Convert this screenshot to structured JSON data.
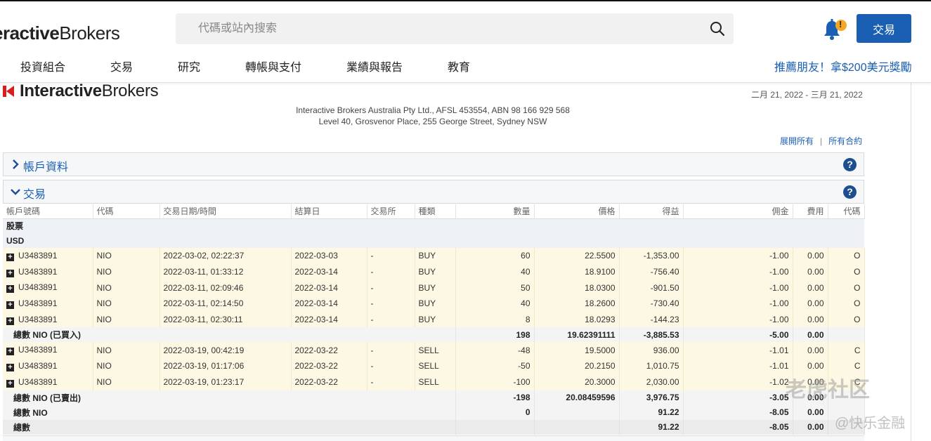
{
  "header": {
    "logo_bold": "eractive",
    "logo_regular": "Brokers",
    "search_placeholder": "代碼或站內搜索",
    "trade_button": "交易",
    "notification_badge": "!",
    "nav": [
      "投資組合",
      "交易",
      "研究",
      "轉帳與支付",
      "業績與報告",
      "教育"
    ],
    "promo": "推薦朋友！拿$200美元獎勵"
  },
  "statement": {
    "logo_bold": "Interactive",
    "logo_regular": "Brokers",
    "period": "二月 21, 2022 - 三月 21, 2022",
    "address_line1": "Interactive Brokers Australia Pty Ltd., AFSL 453554, ABN 98 166 929 568",
    "address_line2": "Level 40, Grosvenor Place, 255 George Street, Sydney NSW",
    "expand_all": "展開所有",
    "all_contracts": "所有合約",
    "section_account": "帳戶資料",
    "section_trades": "交易",
    "help": "?"
  },
  "table": {
    "columns": [
      "帳戶號碼",
      "代碼",
      "交易日期/時間",
      "結算日",
      "交易所",
      "種類",
      "數量",
      "價格",
      "得益",
      "佣金",
      "費用",
      "代碼"
    ],
    "group_asset": "股票",
    "group_currency": "USD",
    "buy_rows": [
      {
        "account": "U3483891",
        "symbol": "NIO",
        "datetime": "2022-03-02, 02:22:37",
        "settle": "2022-03-03",
        "exchange": "-",
        "type": "BUY",
        "qty": "60",
        "price": "22.5500",
        "proceeds": "-1,353.00",
        "comm": "-1.00",
        "fee": "0.00",
        "code": "O"
      },
      {
        "account": "U3483891",
        "symbol": "NIO",
        "datetime": "2022-03-11, 01:33:12",
        "settle": "2022-03-14",
        "exchange": "-",
        "type": "BUY",
        "qty": "40",
        "price": "18.9100",
        "proceeds": "-756.40",
        "comm": "-1.00",
        "fee": "0.00",
        "code": "O"
      },
      {
        "account": "U3483891",
        "symbol": "NIO",
        "datetime": "2022-03-11, 02:09:46",
        "settle": "2022-03-14",
        "exchange": "-",
        "type": "BUY",
        "qty": "50",
        "price": "18.0300",
        "proceeds": "-901.50",
        "comm": "-1.00",
        "fee": "0.00",
        "code": "O"
      },
      {
        "account": "U3483891",
        "symbol": "NIO",
        "datetime": "2022-03-11, 02:14:50",
        "settle": "2022-03-14",
        "exchange": "-",
        "type": "BUY",
        "qty": "40",
        "price": "18.2600",
        "proceeds": "-730.40",
        "comm": "-1.00",
        "fee": "0.00",
        "code": "O"
      },
      {
        "account": "U3483891",
        "symbol": "NIO",
        "datetime": "2022-03-11, 02:30:11",
        "settle": "2022-03-14",
        "exchange": "-",
        "type": "BUY",
        "qty": "8",
        "price": "18.0293",
        "proceeds": "-144.23",
        "comm": "-1.00",
        "fee": "0.00",
        "code": "O"
      }
    ],
    "buy_total": {
      "label": "總數 NIO (已買入)",
      "qty": "198",
      "price": "19.62391111",
      "proceeds": "-3,885.53",
      "comm": "-5.00",
      "fee": "0.00"
    },
    "sell_rows": [
      {
        "account": "U3483891",
        "symbol": "NIO",
        "datetime": "2022-03-19, 00:42:19",
        "settle": "2022-03-22",
        "exchange": "-",
        "type": "SELL",
        "qty": "-48",
        "price": "19.5000",
        "proceeds": "936.00",
        "comm": "-1.01",
        "fee": "0.00",
        "code": "C"
      },
      {
        "account": "U3483891",
        "symbol": "NIO",
        "datetime": "2022-03-19, 01:17:06",
        "settle": "2022-03-22",
        "exchange": "-",
        "type": "SELL",
        "qty": "-50",
        "price": "20.2150",
        "proceeds": "1,010.75",
        "comm": "-1.01",
        "fee": "0.00",
        "code": "C"
      },
      {
        "account": "U3483891",
        "symbol": "NIO",
        "datetime": "2022-03-19, 01:23:17",
        "settle": "2022-03-22",
        "exchange": "-",
        "type": "SELL",
        "qty": "-100",
        "price": "20.3000",
        "proceeds": "2,030.00",
        "comm": "-1.02",
        "fee": "0.00",
        "code": "C"
      }
    ],
    "sell_total": {
      "label": "總數 NIO (已賣出)",
      "qty": "-198",
      "price": "20.08459596",
      "proceeds": "3,976.75",
      "comm": "-3.05",
      "fee": "0.00"
    },
    "nio_total": {
      "label": "總數 NIO",
      "qty": "0",
      "price": "",
      "proceeds": "91.22",
      "comm": "-8.05",
      "fee": "0.00"
    },
    "grand_total": {
      "label": "總數",
      "qty": "",
      "price": "",
      "proceeds": "91.22",
      "comm": "-8.05",
      "fee": "0.00"
    }
  },
  "watermark": {
    "line1": "老虎社区",
    "line2": "@快乐金融"
  },
  "colors": {
    "accent": "#1a5fb4",
    "trade_row": "#fdf8e3",
    "help_icon": "#1d4e8f",
    "bell": "#1a5fb4",
    "badge": "#f5a623"
  }
}
